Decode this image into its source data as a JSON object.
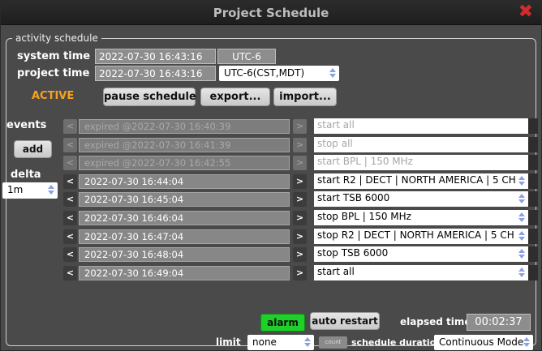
{
  "window": {
    "title": "Project Schedule"
  },
  "section": {
    "legend": "activity schedule"
  },
  "system_time": {
    "label": "system time",
    "value": "2022-07-30 16:43:16",
    "tz": "UTC-6"
  },
  "project_time": {
    "label": "project time",
    "value": "2022-07-30 16:43:16",
    "tz": "UTC-6(CST,MDT)"
  },
  "status": {
    "text": "ACTIVE",
    "color": "#f5a21c"
  },
  "toolbar": {
    "pause": "pause schedule",
    "export": "export...",
    "import": "import..."
  },
  "events_panel": {
    "label": "events",
    "add": "add",
    "delta_label": "delta",
    "delta_value": "1m"
  },
  "events": [
    {
      "time": "expired @2022-07-30 16:40:39",
      "action": "start all",
      "expired": true
    },
    {
      "time": "expired @2022-07-30 16:41:39",
      "action": "stop all",
      "expired": true
    },
    {
      "time": "expired @2022-07-30 16:42:55",
      "action": "start BPL | 150 MHz",
      "expired": true
    },
    {
      "time": "2022-07-30 16:44:04",
      "action": "start R2 | DECT | NORTH AMERICA | 5 CH",
      "expired": false
    },
    {
      "time": "2022-07-30 16:45:04",
      "action": "start TSB 6000",
      "expired": false
    },
    {
      "time": "2022-07-30 16:46:04",
      "action": "stop BPL | 150 MHz",
      "expired": false
    },
    {
      "time": "2022-07-30 16:47:04",
      "action": "stop R2 | DECT | NORTH AMERICA | 5 CH",
      "expired": false
    },
    {
      "time": "2022-07-30 16:48:04",
      "action": "stop TSB 6000",
      "expired": false
    },
    {
      "time": "2022-07-30 16:49:04",
      "action": "start all",
      "expired": false
    }
  ],
  "nav": {
    "prev": "<",
    "next": ">"
  },
  "footer": {
    "alarm": "alarm",
    "auto_restart": "auto restart",
    "elapsed_label": "elapsed time",
    "elapsed_value": "00:02:37",
    "limit_label": "limit",
    "limit_value": "none",
    "count": "count",
    "duration_label": "schedule duration",
    "duration_value": "Continuous Mode"
  },
  "colors": {
    "accent_active": "#f5a21c",
    "alarm": "#1fcf2a",
    "close": "#d42a2a"
  }
}
